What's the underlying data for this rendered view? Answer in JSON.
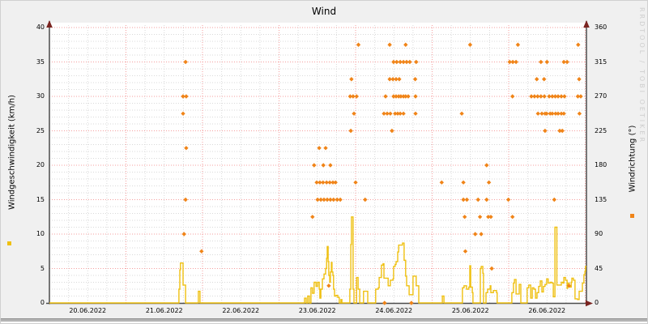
{
  "watermark": "RRDTOOL / TOBI OETIKER",
  "chart_data": {
    "type": "line",
    "title": "Wind",
    "grid": {
      "major_color": "#f59e9e",
      "minor_color": "#d9d9d9",
      "axis_color": "#4c4c4c",
      "arrow_color": "#7a2420",
      "plot_bg": "#ffffff",
      "page_bg": "#f0f0f0"
    },
    "x_axis": {
      "unit": "hours since 20.06.2022 00:00",
      "range": [
        0,
        168.4
      ],
      "labels": [
        "20.06.2022",
        "21.06.2022",
        "22.06.2022",
        "23.06.2022",
        "24.06.2022",
        "25.06.2022",
        "26.06.2022"
      ],
      "major_grid_hours": 24,
      "minor_grid_hours": 6
    },
    "y_left": {
      "label": "Windgeschwindigkeit (km/h)",
      "min": 0,
      "max": 40,
      "minor_step": 1,
      "ticks": [
        0,
        5,
        10,
        15,
        20,
        25,
        30,
        35,
        40
      ]
    },
    "y_right": {
      "label": "Windrichtung (°)",
      "min": 0,
      "max": 360,
      "ticks": [
        0,
        45,
        90,
        135,
        180,
        225,
        270,
        315,
        360
      ]
    },
    "series": [
      {
        "name": "Windgeschwindigkeit (km/h)",
        "type": "step-line",
        "axis": "left",
        "color": "#efc010",
        "points": [
          [
            0,
            0
          ],
          [
            40.4,
            0
          ],
          [
            40.6,
            2
          ],
          [
            40.9,
            4.8
          ],
          [
            41.1,
            5.8
          ],
          [
            41.9,
            2.6
          ],
          [
            42.7,
            0
          ],
          [
            46.7,
            1.7
          ],
          [
            47.2,
            0
          ],
          [
            79.7,
            0
          ],
          [
            80,
            0.7
          ],
          [
            80.5,
            0
          ],
          [
            81,
            1
          ],
          [
            81.5,
            0
          ],
          [
            82,
            2.2
          ],
          [
            82.5,
            1.4
          ],
          [
            83,
            3
          ],
          [
            83.6,
            2.4
          ],
          [
            84.1,
            3
          ],
          [
            84.6,
            2
          ],
          [
            84.8,
            0.7
          ],
          [
            85.1,
            2
          ],
          [
            85.6,
            3.5
          ],
          [
            86.1,
            4.2
          ],
          [
            86.6,
            5
          ],
          [
            86.9,
            6.5
          ],
          [
            87.1,
            8.2
          ],
          [
            87.4,
            6
          ],
          [
            87.6,
            4
          ],
          [
            87.9,
            3
          ],
          [
            88.1,
            4.5
          ],
          [
            88.4,
            5.9
          ],
          [
            88.6,
            4.5
          ],
          [
            88.9,
            4
          ],
          [
            89.1,
            2
          ],
          [
            89.4,
            1
          ],
          [
            89.9,
            1.1
          ],
          [
            90.4,
            0.8
          ],
          [
            90.9,
            0
          ],
          [
            91.4,
            0.5
          ],
          [
            91.7,
            0
          ],
          [
            94.2,
            2
          ],
          [
            94.5,
            8.5
          ],
          [
            94.7,
            12.5
          ],
          [
            95.1,
            12.5
          ],
          [
            95.2,
            2
          ],
          [
            95.5,
            0
          ],
          [
            96.3,
            3.7
          ],
          [
            96.8,
            2
          ],
          [
            97.3,
            0
          ],
          [
            98.5,
            1.7
          ],
          [
            99.6,
            1.7
          ],
          [
            99.8,
            0
          ],
          [
            102.1,
            0
          ],
          [
            102.3,
            2
          ],
          [
            103.1,
            2.2
          ],
          [
            103.4,
            3.7
          ],
          [
            104.1,
            5.5
          ],
          [
            104.6,
            5.7
          ],
          [
            104.9,
            3.6
          ],
          [
            105.9,
            3.6
          ],
          [
            106.2,
            2.5
          ],
          [
            106.9,
            3.3
          ],
          [
            107.7,
            3.5
          ],
          [
            107.9,
            5.3
          ],
          [
            108.4,
            5.6
          ],
          [
            108.7,
            6
          ],
          [
            109.2,
            7.4
          ],
          [
            109.5,
            8.4
          ],
          [
            110.2,
            8.4
          ],
          [
            110.7,
            8.7
          ],
          [
            111,
            8.7
          ],
          [
            111.2,
            6.2
          ],
          [
            111.7,
            3.9
          ],
          [
            112,
            2.5
          ],
          [
            112.8,
            1.2
          ],
          [
            113.8,
            1.2
          ],
          [
            114,
            3.9
          ],
          [
            114.8,
            3.9
          ],
          [
            115,
            2.5
          ],
          [
            115.8,
            0
          ],
          [
            123.2,
            1
          ],
          [
            123.7,
            0
          ],
          [
            129.3,
            0
          ],
          [
            129.5,
            2.2
          ],
          [
            130,
            2.5
          ],
          [
            130.8,
            2
          ],
          [
            131.5,
            2.3
          ],
          [
            131.8,
            5.4
          ],
          [
            132.1,
            2.3
          ],
          [
            132.6,
            1.5
          ],
          [
            132.8,
            0
          ],
          [
            135.1,
            5
          ],
          [
            135.4,
            5.3
          ],
          [
            135.9,
            4.3
          ],
          [
            136.1,
            0
          ],
          [
            136.9,
            1.5
          ],
          [
            137.4,
            2
          ],
          [
            138.2,
            2.5
          ],
          [
            138.4,
            1.5
          ],
          [
            139.2,
            1.8
          ],
          [
            140.2,
            1.5
          ],
          [
            140.4,
            0
          ],
          [
            144.8,
            0
          ],
          [
            145,
            1.5
          ],
          [
            145.5,
            2.9
          ],
          [
            145.8,
            3.4
          ],
          [
            146.3,
            1.3
          ],
          [
            147.3,
            2.7
          ],
          [
            147.8,
            0
          ],
          [
            149.8,
            2.2
          ],
          [
            150.3,
            2.6
          ],
          [
            150.9,
            0.7
          ],
          [
            151.4,
            2.2
          ],
          [
            151.9,
            2
          ],
          [
            152.4,
            0.7
          ],
          [
            152.9,
            1.5
          ],
          [
            153.4,
            2.4
          ],
          [
            153.9,
            3.2
          ],
          [
            154.4,
            1.6
          ],
          [
            154.9,
            2.4
          ],
          [
            155.4,
            2.7
          ],
          [
            155.9,
            3.5
          ],
          [
            156.4,
            2.9
          ],
          [
            157,
            3
          ],
          [
            157.5,
            2.9
          ],
          [
            158,
            0.9
          ],
          [
            158.5,
            11
          ],
          [
            159,
            11
          ],
          [
            159.1,
            2.6
          ],
          [
            159.7,
            2.6
          ],
          [
            160.5,
            3
          ],
          [
            161,
            2.9
          ],
          [
            161.3,
            3.7
          ],
          [
            161.8,
            3.3
          ],
          [
            162.3,
            2.1
          ],
          [
            162.5,
            2.9
          ],
          [
            163,
            2.3
          ],
          [
            163.6,
            3
          ],
          [
            163.8,
            3.6
          ],
          [
            164.3,
            3.3
          ],
          [
            164.8,
            0.6
          ],
          [
            165.6,
            0.5
          ],
          [
            166.1,
            1.7
          ],
          [
            166.9,
            1.7
          ],
          [
            167.1,
            2.9
          ],
          [
            167.6,
            4.1
          ],
          [
            167.9,
            4.6
          ],
          [
            168.1,
            5.3
          ],
          [
            168.4,
            5.3
          ]
        ]
      },
      {
        "name": "Windrichtung (°)",
        "type": "scatter",
        "axis": "right",
        "color": "#f08418",
        "marker": "diamond",
        "points": [
          [
            41.9,
            270
          ],
          [
            42.9,
            270
          ],
          [
            41.9,
            247.5
          ],
          [
            42.7,
            315
          ],
          [
            42.9,
            202.5
          ],
          [
            42.7,
            135
          ],
          [
            42.2,
            90
          ],
          [
            47.7,
            67.5
          ],
          [
            82.5,
            112.5
          ],
          [
            83,
            180
          ],
          [
            85.9,
            180
          ],
          [
            88.1,
            180
          ],
          [
            84.6,
            202.5
          ],
          [
            86.6,
            202.5
          ],
          [
            83.8,
            157.5
          ],
          [
            84.8,
            157.5
          ],
          [
            85.8,
            157.5
          ],
          [
            86.9,
            157.5
          ],
          [
            87.9,
            157.5
          ],
          [
            88.9,
            157.5
          ],
          [
            89.7,
            157.5
          ],
          [
            96,
            157.5
          ],
          [
            84.1,
            135
          ],
          [
            85.1,
            135
          ],
          [
            86.1,
            135
          ],
          [
            87.1,
            135
          ],
          [
            88.1,
            135
          ],
          [
            89.1,
            135
          ],
          [
            90.2,
            135
          ],
          [
            91.2,
            135
          ],
          [
            99,
            135
          ],
          [
            87.6,
            22.5
          ],
          [
            96.9,
            337.5
          ],
          [
            94.7,
            292.5
          ],
          [
            94.3,
            270
          ],
          [
            95.2,
            270
          ],
          [
            96.3,
            270
          ],
          [
            95.5,
            247.5
          ],
          [
            94.5,
            225
          ],
          [
            106.7,
            337.5
          ],
          [
            111.7,
            337.5
          ],
          [
            107.9,
            315
          ],
          [
            108.9,
            315
          ],
          [
            110,
            315
          ],
          [
            111,
            315
          ],
          [
            112,
            315
          ],
          [
            113,
            315
          ],
          [
            115,
            315
          ],
          [
            106.7,
            292.5
          ],
          [
            107.7,
            292.5
          ],
          [
            108.7,
            292.5
          ],
          [
            109.7,
            292.5
          ],
          [
            114.7,
            292.5
          ],
          [
            105.4,
            270
          ],
          [
            107.9,
            270
          ],
          [
            108.7,
            270
          ],
          [
            109.5,
            270
          ],
          [
            110.2,
            270
          ],
          [
            111,
            270
          ],
          [
            111.7,
            270
          ],
          [
            112.5,
            270
          ],
          [
            114.8,
            270
          ],
          [
            104.9,
            247.5
          ],
          [
            105.9,
            247.5
          ],
          [
            106.9,
            247.5
          ],
          [
            108.4,
            247.5
          ],
          [
            109.2,
            247.5
          ],
          [
            110,
            247.5
          ],
          [
            111,
            247.5
          ],
          [
            114.8,
            247.5
          ],
          [
            107.4,
            225
          ],
          [
            105.1,
            0
          ],
          [
            113.5,
            0
          ],
          [
            131.9,
            337.5
          ],
          [
            129.3,
            247.5
          ],
          [
            137.1,
            180
          ],
          [
            123,
            157.5
          ],
          [
            129.8,
            157.5
          ],
          [
            137.8,
            157.5
          ],
          [
            129.8,
            135
          ],
          [
            130.9,
            135
          ],
          [
            134.4,
            135
          ],
          [
            137.1,
            135
          ],
          [
            130.2,
            112.5
          ],
          [
            135,
            112.5
          ],
          [
            137.6,
            112.5
          ],
          [
            138.4,
            112.5
          ],
          [
            133.5,
            90
          ],
          [
            135.4,
            90
          ],
          [
            130.4,
            67.5
          ],
          [
            138.7,
            45
          ],
          [
            146.9,
            337.5
          ],
          [
            165.8,
            337.5
          ],
          [
            144.3,
            315
          ],
          [
            145.3,
            315
          ],
          [
            146.3,
            315
          ],
          [
            154.1,
            315
          ],
          [
            156,
            315
          ],
          [
            161.3,
            315
          ],
          [
            162.3,
            315
          ],
          [
            152.8,
            292.5
          ],
          [
            155.1,
            292.5
          ],
          [
            166.1,
            292.5
          ],
          [
            145.2,
            270
          ],
          [
            151.1,
            270
          ],
          [
            152.1,
            270
          ],
          [
            153.1,
            270
          ],
          [
            154.1,
            270
          ],
          [
            155.2,
            270
          ],
          [
            156.7,
            270
          ],
          [
            157.7,
            270
          ],
          [
            158.6,
            270
          ],
          [
            159.5,
            270
          ],
          [
            160.5,
            270
          ],
          [
            161.5,
            270
          ],
          [
            165.7,
            270
          ],
          [
            166.6,
            270
          ],
          [
            153.2,
            247.5
          ],
          [
            154.4,
            247.5
          ],
          [
            155.4,
            247.5
          ],
          [
            155.9,
            247.5
          ],
          [
            157,
            247.5
          ],
          [
            157.7,
            247.5
          ],
          [
            158.7,
            247.5
          ],
          [
            159.5,
            247.5
          ],
          [
            160.5,
            247.5
          ],
          [
            161.3,
            247.5
          ],
          [
            166.2,
            247.5
          ],
          [
            155.4,
            225
          ],
          [
            160,
            225
          ],
          [
            160.8,
            225
          ],
          [
            143.9,
            135
          ],
          [
            158.3,
            135
          ],
          [
            145.2,
            112.5
          ],
          [
            162.9,
            22.5
          ]
        ]
      }
    ]
  }
}
